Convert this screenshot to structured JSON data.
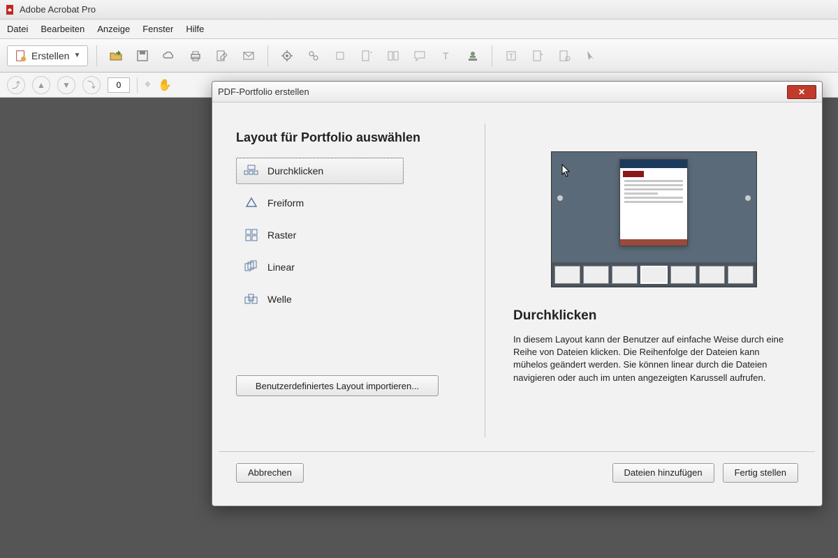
{
  "app": {
    "title": "Adobe Acrobat Pro"
  },
  "menu": {
    "items": [
      "Datei",
      "Bearbeiten",
      "Anzeige",
      "Fenster",
      "Hilfe"
    ]
  },
  "toolbar": {
    "create_label": "Erstellen"
  },
  "subtoolbar": {
    "page": "0"
  },
  "dialog": {
    "title": "PDF-Portfolio erstellen",
    "heading": "Layout für Portfolio auswählen",
    "layouts": [
      {
        "label": "Durchklicken",
        "icon": "click-through-icon",
        "selected": true
      },
      {
        "label": "Freiform",
        "icon": "freeform-icon",
        "selected": false
      },
      {
        "label": "Raster",
        "icon": "grid-icon",
        "selected": false
      },
      {
        "label": "Linear",
        "icon": "linear-icon",
        "selected": false
      },
      {
        "label": "Welle",
        "icon": "wave-icon",
        "selected": false
      }
    ],
    "import_layout_label": "Benutzerdefiniertes Layout importieren...",
    "preview": {
      "title": "Durchklicken",
      "description": "In diesem Layout kann der Benutzer auf einfache Weise durch eine Reihe von Dateien klicken. Die Reihenfolge der Dateien kann mühelos geändert werden. Sie können linear durch die Dateien navigieren oder auch im unten angezeigten Karussell aufrufen."
    },
    "buttons": {
      "cancel": "Abbrechen",
      "add_files": "Dateien hinzufügen",
      "finish": "Fertig stellen"
    }
  }
}
